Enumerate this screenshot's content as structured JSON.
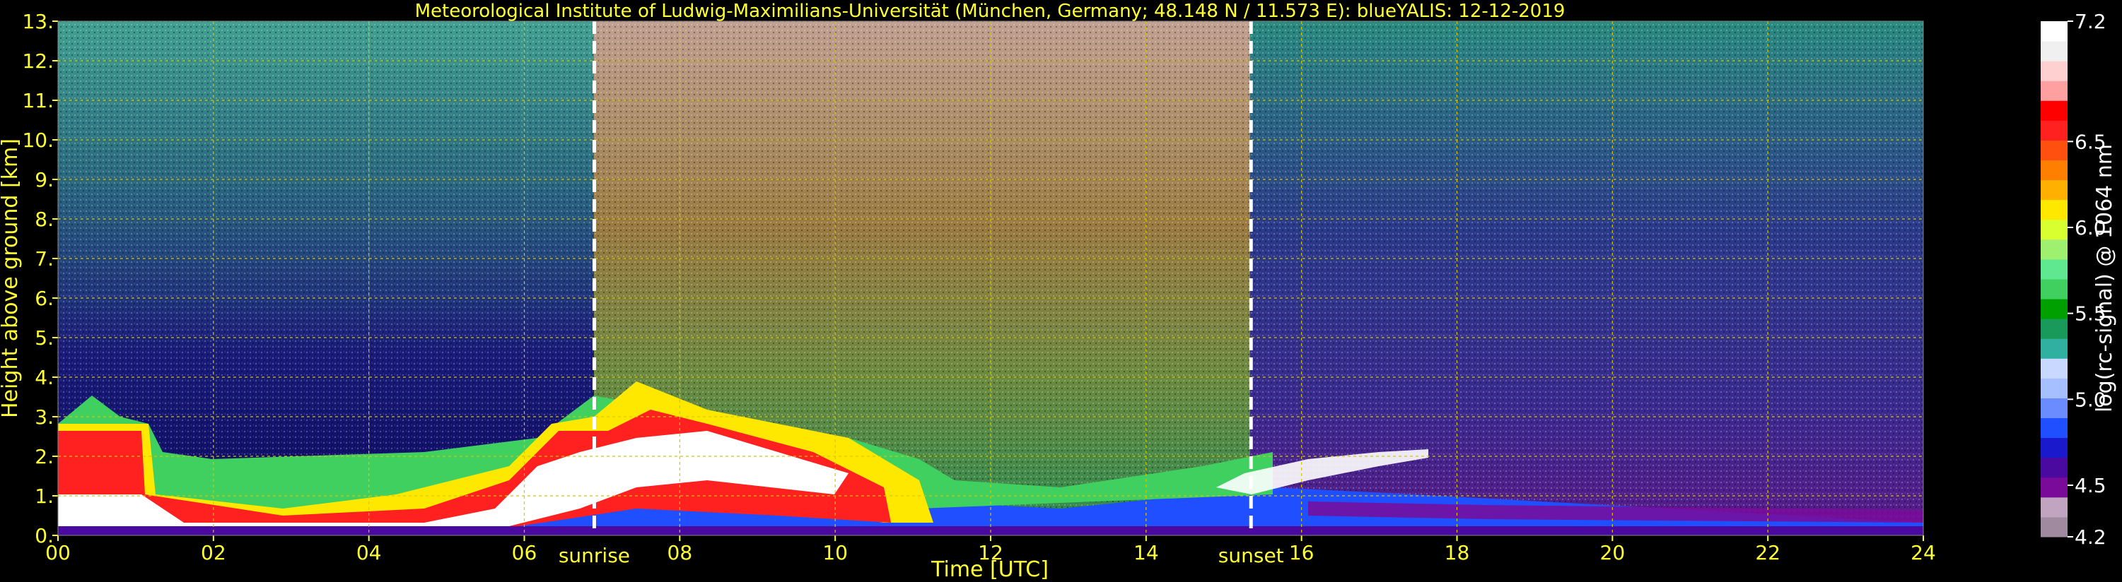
{
  "chart_data": {
    "type": "heatmap",
    "title": "Meteorological Institute of Ludwig-Maximilians-Universität (München, Germany; 48.148 N / 11.573 E):    blueYALIS: 12-12-2019",
    "xlabel": "Time [UTC]",
    "ylabel": "Height above ground [km]",
    "colorbar_label": "log(rc-signal) @ 1064 nm",
    "xlim": [
      0,
      24
    ],
    "ylim": [
      0,
      13
    ],
    "x_ticks": [
      "00",
      "02",
      "04",
      "06",
      "08",
      "10",
      "12",
      "14",
      "16",
      "18",
      "20",
      "22",
      "24"
    ],
    "x_tick_values": [
      0,
      2,
      4,
      6,
      8,
      10,
      12,
      14,
      16,
      18,
      20,
      22,
      24
    ],
    "y_ticks": [
      "0.",
      "1.",
      "2.",
      "3.",
      "4.",
      "5.",
      "6.",
      "7.",
      "8.",
      "9.",
      "10.",
      "11.",
      "12.",
      "13."
    ],
    "y_tick_values": [
      0,
      1,
      2,
      3,
      4,
      5,
      6,
      7,
      8,
      9,
      10,
      11,
      12,
      13
    ],
    "colorbar_range": [
      4.2,
      7.2
    ],
    "colorbar_ticks": [
      "4.2",
      "4.5",
      "5.0",
      "5.5",
      "6.0",
      "6.5",
      "7.2"
    ],
    "colorbar_tick_values": [
      4.2,
      4.5,
      5.0,
      5.5,
      6.0,
      6.5,
      7.2
    ],
    "colormap": [
      "#a08aa0",
      "#c0a4c0",
      "#7a0a9a",
      "#4a0aa0",
      "#1a1acc",
      "#1f4fff",
      "#6a8cff",
      "#a6c0ff",
      "#c8d8ff",
      "#30b0a0",
      "#1a9a5a",
      "#00a000",
      "#40d060",
      "#60e890",
      "#a0f070",
      "#d8ff30",
      "#ffe800",
      "#ffb000",
      "#ff8000",
      "#ff5010",
      "#ff2020",
      "#ff0000",
      "#ffa0a0",
      "#ffd0d0",
      "#f0f0f0",
      "#ffffff"
    ],
    "grid": true,
    "grid_color": "#d4c700",
    "annotations": [
      {
        "text": "sunrise",
        "x": 6.9
      },
      {
        "text": "sunset",
        "x": 15.35
      }
    ],
    "colors": {
      "background": "#000000",
      "text_accent": "#ffff33",
      "text_main": "#ffffff",
      "marker_lines": "#ffffff"
    }
  }
}
